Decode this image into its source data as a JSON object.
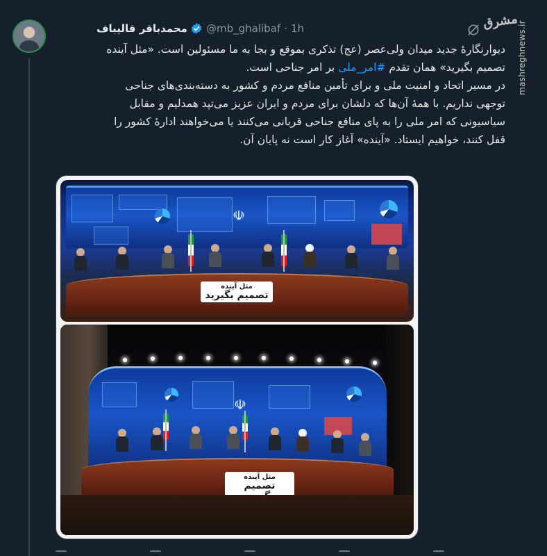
{
  "tweet": {
    "author_name": "محمدباقر قالیباف",
    "handle": "@mb_ghalibaf",
    "separator": "·",
    "time": "1h",
    "verified": true,
    "text_lines": [
      "دیوارنگارهٔ جدید میدان ولی‌عصر (عج) تذکری بموقع و بجا به ما مسئولین است. «مثل آینده"
    ],
    "line2_before": "تصمیم بگیرید» همان تقدم ",
    "hashtag": "#امر_ملی",
    "line2_after": " بر امر جناحی است.",
    "paragraph_lines": [
      "در مسیر اتحاد و امنیت ملی و برای تأمین منافع مردم و کشور به دسته‌بندی‌های جناحی",
      "توجهی نداریم. با همهٔ آن‌ها که دلشان برای مردم و ایران عزیز می‌تپد همدلیم و مقابل",
      "سیاسیونی که امر ملی را به پای منافع جناحی قربانی می‌کنند یا می‌خواهند ادارهٔ کشور را",
      "قفل کنند، خواهیم ایستاد. «آینده» آغاز کار است نه پایان آن."
    ]
  },
  "media": {
    "sign_line1": "مثل آینده",
    "sign_line2": "تصمیم بگیرید"
  },
  "watermark": {
    "logo": "مشرق",
    "site": "mashreghnews.ir"
  },
  "colors": {
    "background": "#15202b",
    "hashtag": "#1d9bf0",
    "verified_badge": "#1d9bf0",
    "secondary_text": "#8b98a5"
  }
}
